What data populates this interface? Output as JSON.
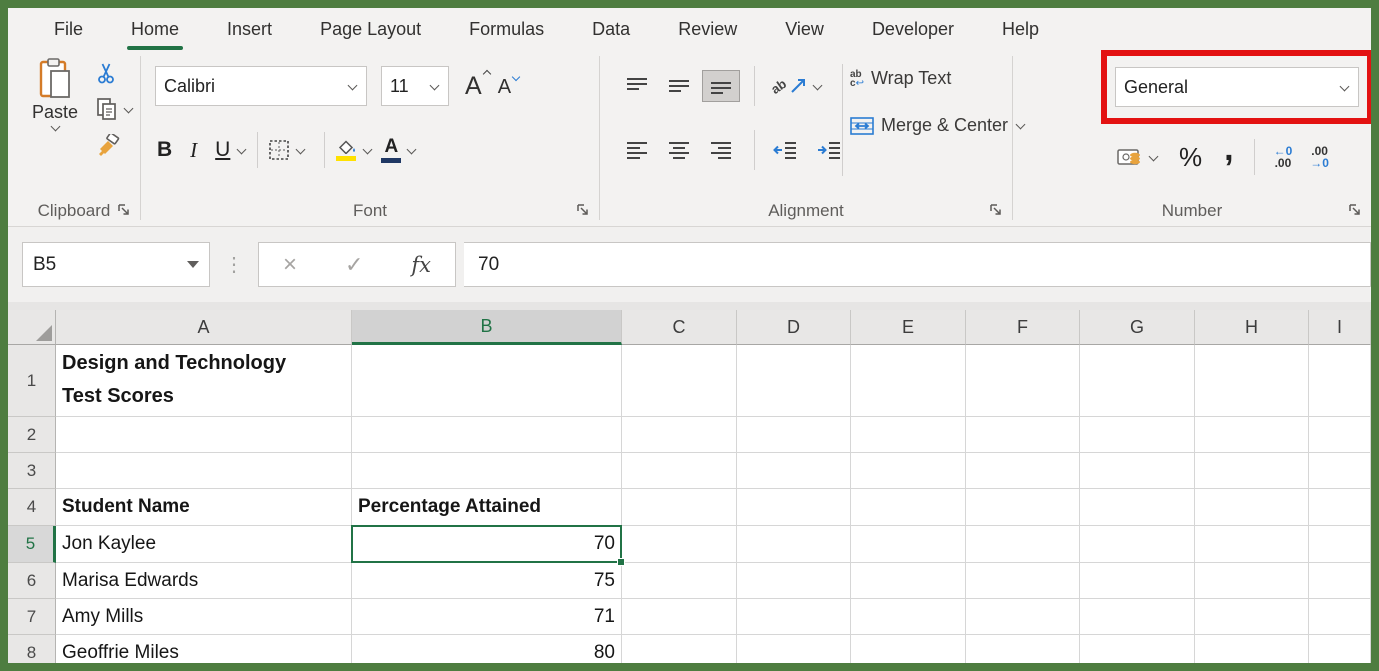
{
  "colors": {
    "frame_green": "#4e7d40",
    "excel_green": "#217346",
    "highlight_red": "#e31212",
    "accent_blue": "#2b7cd3"
  },
  "tabs": [
    {
      "label": "File"
    },
    {
      "label": "Home"
    },
    {
      "label": "Insert"
    },
    {
      "label": "Page Layout"
    },
    {
      "label": "Formulas"
    },
    {
      "label": "Data"
    },
    {
      "label": "Review"
    },
    {
      "label": "View"
    },
    {
      "label": "Developer"
    },
    {
      "label": "Help"
    }
  ],
  "active_tab": "Home",
  "clipboard": {
    "label": "Clipboard",
    "paste": "Paste"
  },
  "font_group": {
    "label": "Font",
    "name": "Calibri",
    "size": "11",
    "bold": "B",
    "italic": "I",
    "underline": "U",
    "grow": "A",
    "shrink": "A"
  },
  "alignment": {
    "label": "Alignment",
    "wrap": "Wrap Text",
    "merge": "Merge & Center",
    "wrap_ab": "ab",
    "wrap_c": "c",
    "wrap_return": "↩",
    "orient_ab": "ab"
  },
  "number": {
    "label": "Number",
    "format": "General",
    "percent": "%",
    "comma": ",",
    "inc_decimal_top": "←0",
    "inc_decimal_bottom": ".00",
    "dec_decimal_top": ".00",
    "dec_decimal_bottom": "→0"
  },
  "formula_bar": {
    "name_box": "B5",
    "cancel": "×",
    "enter": "✓",
    "fx": "fx",
    "value": "70",
    "dots": "⋮"
  },
  "sheet": {
    "col_headers": [
      "A",
      "B",
      "C",
      "D",
      "E",
      "F",
      "G",
      "H",
      "I"
    ],
    "selected_cell": "B5",
    "selected_column": "B",
    "selected_row": "5",
    "rows": [
      {
        "n": "1",
        "a": "Design and Technology Test Scores",
        "b": ""
      },
      {
        "n": "2",
        "a": "",
        "b": ""
      },
      {
        "n": "3",
        "a": "",
        "b": ""
      },
      {
        "n": "4",
        "a": "Student Name",
        "b": "Percentage Attained"
      },
      {
        "n": "5",
        "a": "Jon Kaylee",
        "b": "70"
      },
      {
        "n": "6",
        "a": "Marisa Edwards",
        "b": "75"
      },
      {
        "n": "7",
        "a": "Amy Mills",
        "b": "71"
      },
      {
        "n": "8",
        "a": "Geoffrie Miles",
        "b": "80"
      }
    ]
  }
}
